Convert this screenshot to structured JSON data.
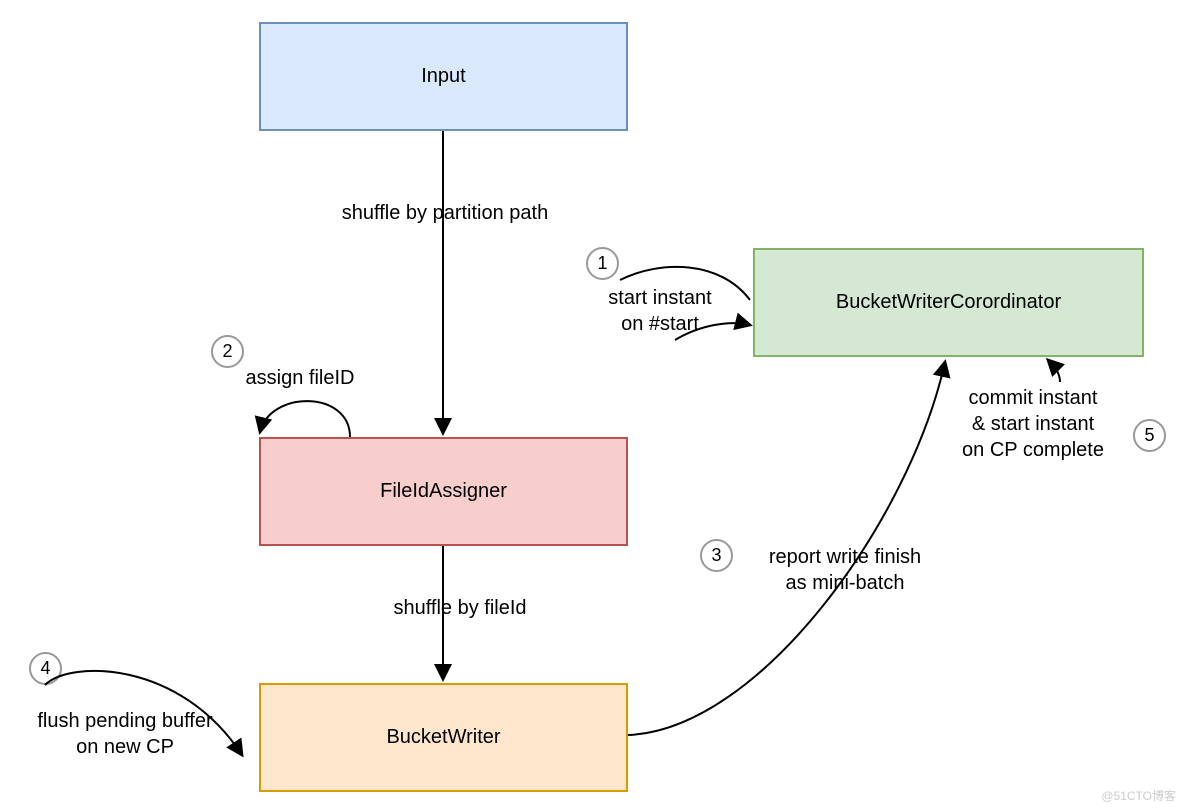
{
  "nodes": {
    "input": "Input",
    "fileIdAssigner": "FileIdAssigner",
    "bucketWriter": "BucketWriter",
    "coordinator": "BucketWriterCorordinator"
  },
  "edges": {
    "shuffleByPartition": "shuffle by partition path",
    "shuffleByFileId": "shuffle by fileId",
    "assignFileId": "assign fileID",
    "startInstant": "start instant\non #start",
    "reportWriteFinish": "report write finish\nas mini-batch",
    "flushPending": "flush pending buffer\non new CP",
    "commitInstant": "commit instant\n& start instant\non CP complete"
  },
  "badges": {
    "b1": "1",
    "b2": "2",
    "b3": "3",
    "b4": "4",
    "b5": "5"
  },
  "watermark": "@51CTO博客"
}
